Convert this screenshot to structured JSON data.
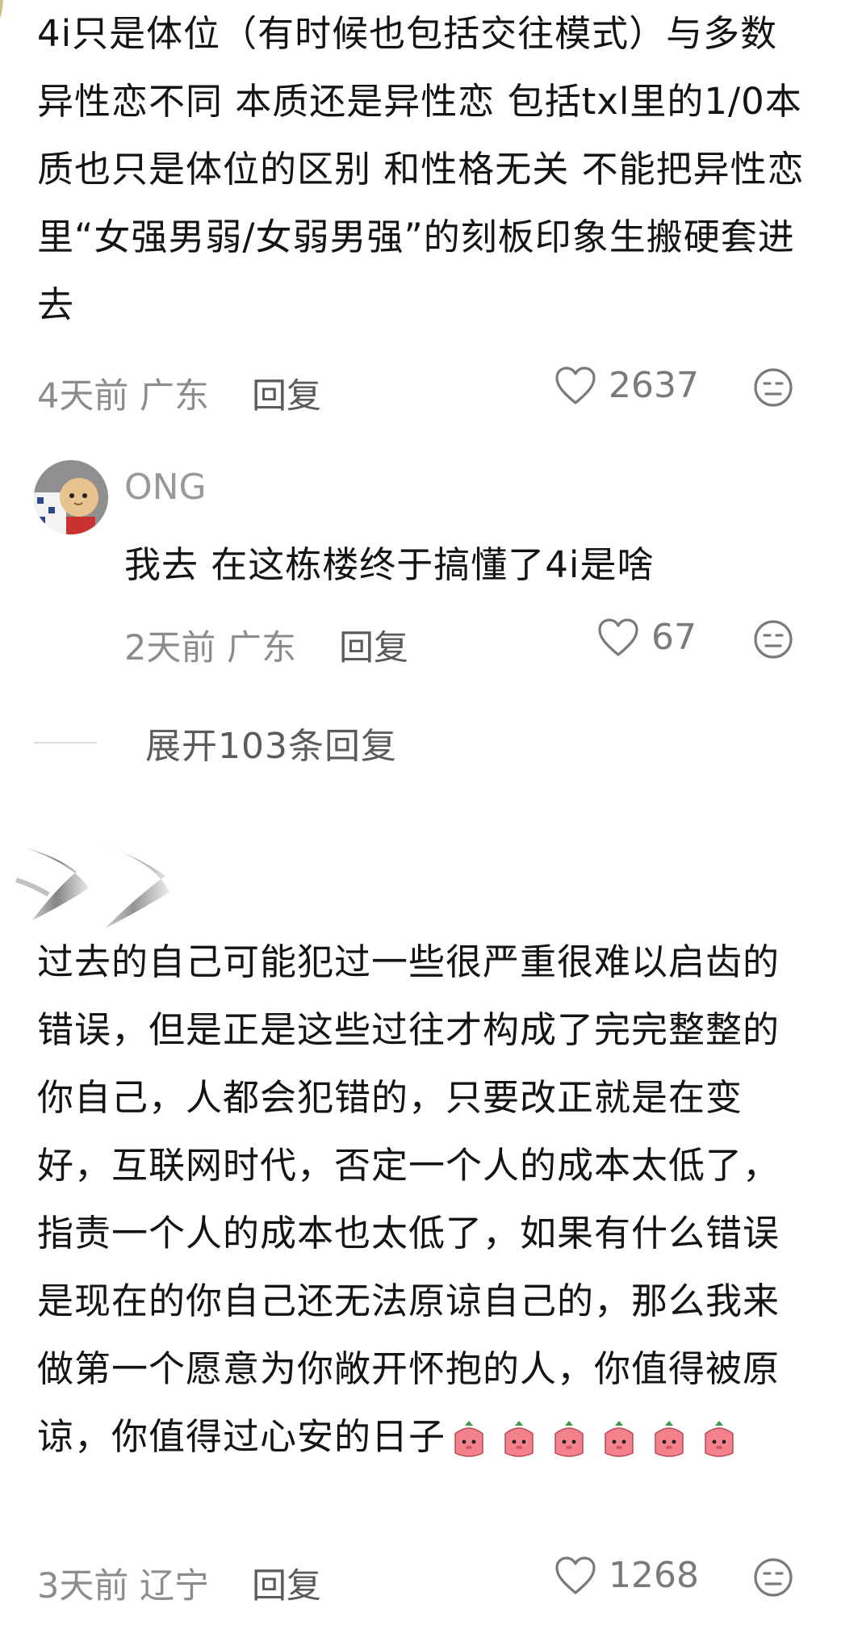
{
  "comments": [
    {
      "text": "4i只是体位（有时候也包括交往模式）与多数异性恋不同 本质还是异性恋 包括txl里的1/0本质也只是体位的区别 和性格无关 不能把异性恋里“女强男弱/女弱男强”的刻板印象生搬硬套进去",
      "time": "4天前 广东",
      "reply_label": "回复",
      "likes": "2637"
    },
    {
      "username": "ONG",
      "text": "我去 在这栋楼终于搞懂了4i是啥",
      "time": "2天前 广东",
      "reply_label": "回复",
      "likes": "67"
    },
    {
      "text": "过去的自己可能犯过一些很严重很难以启齿的错误，但是正是这些过往才构成了完完整整的你自己，人都会犯错的，只要改正就是在变好，互联网时代，否定一个人的成本太低了，指责一个人的成本也太低了，如果有什么错误是现在的你自己还无法原谅自己的，那么我来做第一个愿意为你敞开怀抱的人，你值得被原谅，你值得过心安的日子",
      "time": "3天前 辽宁",
      "reply_label": "回复",
      "likes": "1268"
    }
  ],
  "expand_replies": "展开103条回复",
  "icons": {
    "like": "heart-outline-icon",
    "dislike": "meh-face-icon",
    "sticker": "peach-sticker-icon"
  }
}
